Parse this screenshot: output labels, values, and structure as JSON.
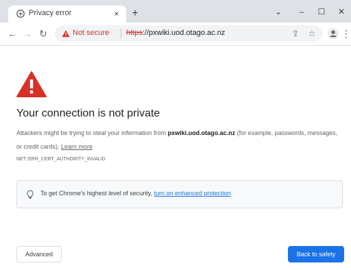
{
  "tab": {
    "title": "Privacy error",
    "favicon": "chrome-warning-favicon",
    "close_glyph": "×"
  },
  "new_tab_glyph": "+",
  "window_controls": {
    "tab_search_glyph": "⌄",
    "minimize_glyph": "–",
    "maximize_glyph": "☐",
    "close_glyph": "✕"
  },
  "toolbar": {
    "back_glyph": "←",
    "forward_glyph": "→",
    "reload_glyph": "↻",
    "not_secure_label": "Not secure",
    "url_scheme": "https",
    "url_rest": "://pxwiki.uod.otago.ac.nz",
    "share_glyph": "⇪",
    "bookmark_glyph": "☆",
    "menu_glyph": "⋮"
  },
  "page": {
    "heading": "Your connection is not private",
    "desc_prefix": "Attackers might be trying to steal your information from ",
    "desc_host": "pxwiki.uod.otago.ac.nz",
    "desc_suffix": " (for example, passwords, messages, or credit cards). ",
    "learn_more": "Learn more",
    "error_code": "NET::ERR_CERT_AUTHORITY_INVALID",
    "enhanced_prefix": "To get Chrome's highest level of security, ",
    "enhanced_link": "turn on enhanced protection",
    "advanced_button": "Advanced",
    "back_button": "Back to safety"
  },
  "colors": {
    "tabstrip_bg": "#dee1e6",
    "warning_red": "#d93025",
    "link_blue": "#1a73e8",
    "primary_button_bg": "#1a73e8",
    "box_bg": "#f8f9fa"
  },
  "icons": {
    "warning": "warning-triangle-icon",
    "bulb": "lightbulb-icon",
    "profile": "profile-avatar-icon"
  }
}
